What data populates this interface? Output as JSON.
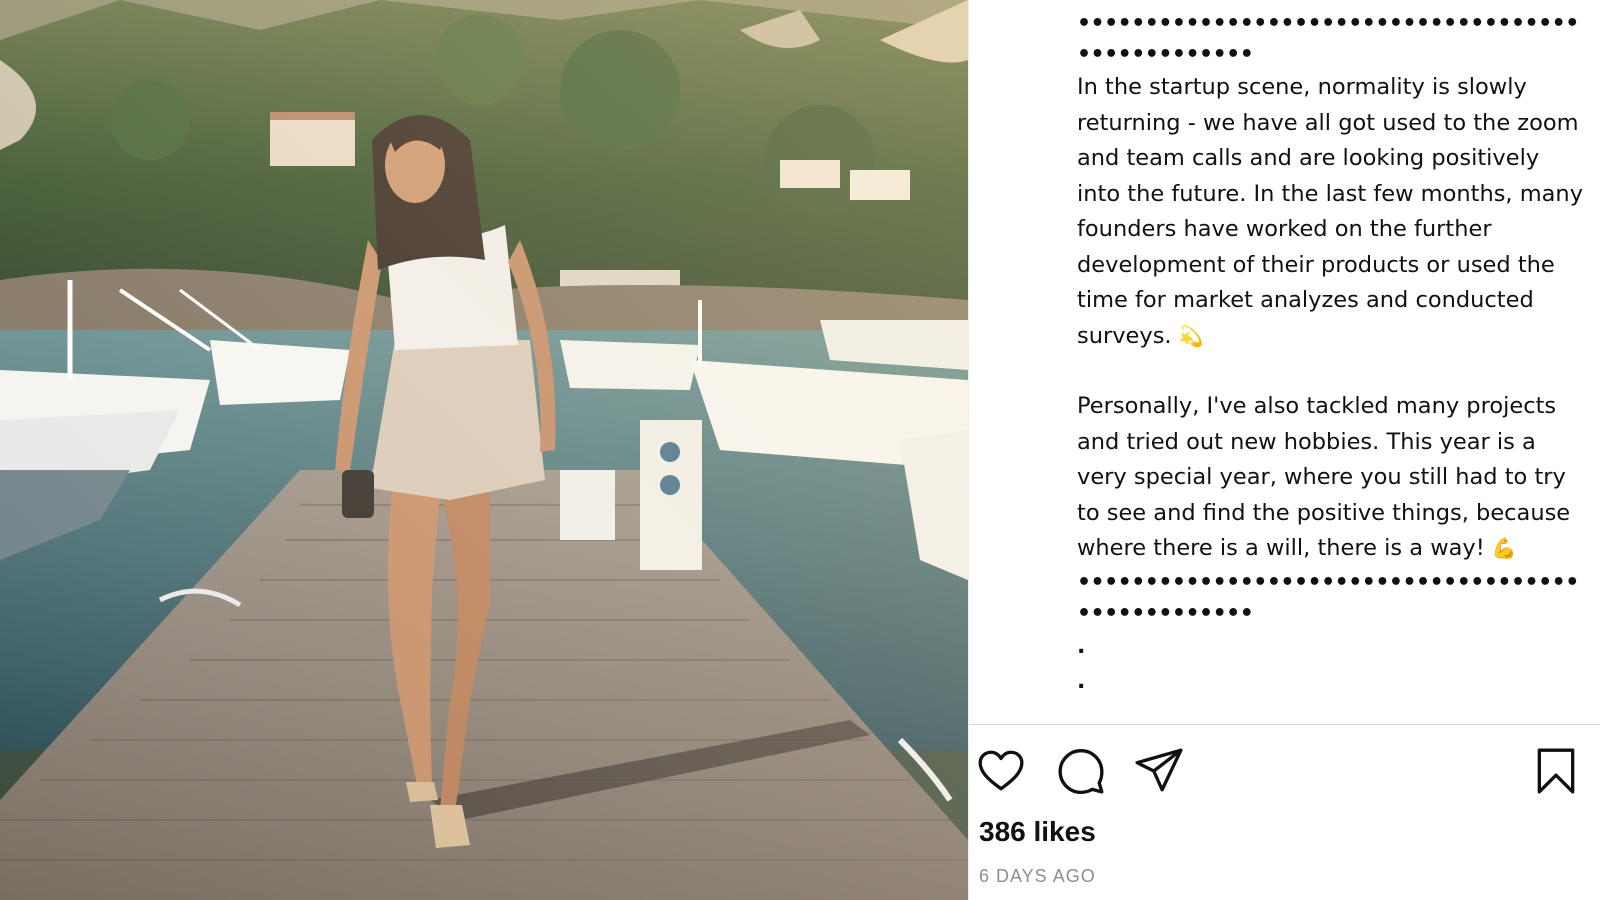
{
  "post": {
    "caption": {
      "separator": "••••••••••••••••••••••••••••••••••••••••••••••••••",
      "paragraph1": "In the startup scene, normality is slowly returning - we have all got used to the zoom and team calls and are looking positively into the future. In the last few months, many founders have worked on the further development of their products or used the time for market analyzes and conducted surveys.",
      "paragraph1_emoji": "💫",
      "paragraph2": "Personally, I've also tackled many projects and tried out new hobbies. This year is a very special year, where you still had to try to see and find the positive things, because where there is a will, there is a way!",
      "paragraph2_emoji": "💪",
      "trailing_dot_1": ".",
      "trailing_dot_2": "."
    },
    "actions": {
      "like_icon": "heart-outline-icon",
      "comment_icon": "comment-bubble-icon",
      "share_icon": "paper-plane-icon",
      "save_icon": "bookmark-outline-icon"
    },
    "likes_text": "386 likes",
    "timestamp": "6 DAYS AGO"
  },
  "colors": {
    "text": "#111111",
    "muted": "#8e8e8e",
    "divider": "#dbdbdb"
  }
}
